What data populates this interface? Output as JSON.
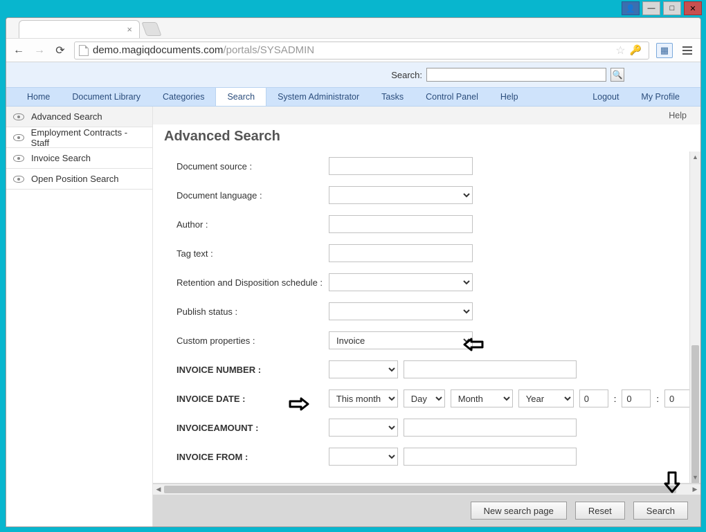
{
  "window": {
    "url_domain": "demo.magiqdocuments.com",
    "url_path": "/portals/SYSADMIN"
  },
  "topsearch": {
    "label": "Search:",
    "value": ""
  },
  "nav": {
    "home": "Home",
    "doclib": "Document Library",
    "categories": "Categories",
    "search": "Search",
    "sysadmin": "System Administrator",
    "tasks": "Tasks",
    "cpanel": "Control Panel",
    "help": "Help",
    "logout": "Logout",
    "profile": "My Profile"
  },
  "sidebar": {
    "items": [
      {
        "label": "Advanced Search"
      },
      {
        "label": "Employment Contracts - Staff"
      },
      {
        "label": "Invoice Search"
      },
      {
        "label": "Open Position Search"
      }
    ]
  },
  "page": {
    "help": "Help",
    "title": "Advanced Search"
  },
  "form": {
    "doc_source": {
      "label": "Document source :",
      "value": ""
    },
    "doc_lang": {
      "label": "Document language :",
      "value": ""
    },
    "author": {
      "label": "Author :",
      "value": ""
    },
    "tag_text": {
      "label": "Tag text :",
      "value": ""
    },
    "retention": {
      "label": "Retention and Disposition schedule :",
      "value": ""
    },
    "publish": {
      "label": "Publish status :",
      "value": ""
    },
    "custom": {
      "label": "Custom properties :",
      "value": "Invoice"
    },
    "inv_num": {
      "label": "INVOICE NUMBER :",
      "op": "",
      "value": ""
    },
    "inv_date": {
      "label": "INVOICE DATE :",
      "range": "This month",
      "day": "Day",
      "month": "Month",
      "year": "Year",
      "h": "0",
      "m": "0",
      "s": "0",
      "colon": ":"
    },
    "inv_amt": {
      "label": "INVOICEAMOUNT :",
      "op": "",
      "value": ""
    },
    "inv_from": {
      "label": "INVOICE FROM :",
      "op": "",
      "value": ""
    }
  },
  "footer": {
    "new": "New search page",
    "reset": "Reset",
    "search": "Search"
  }
}
